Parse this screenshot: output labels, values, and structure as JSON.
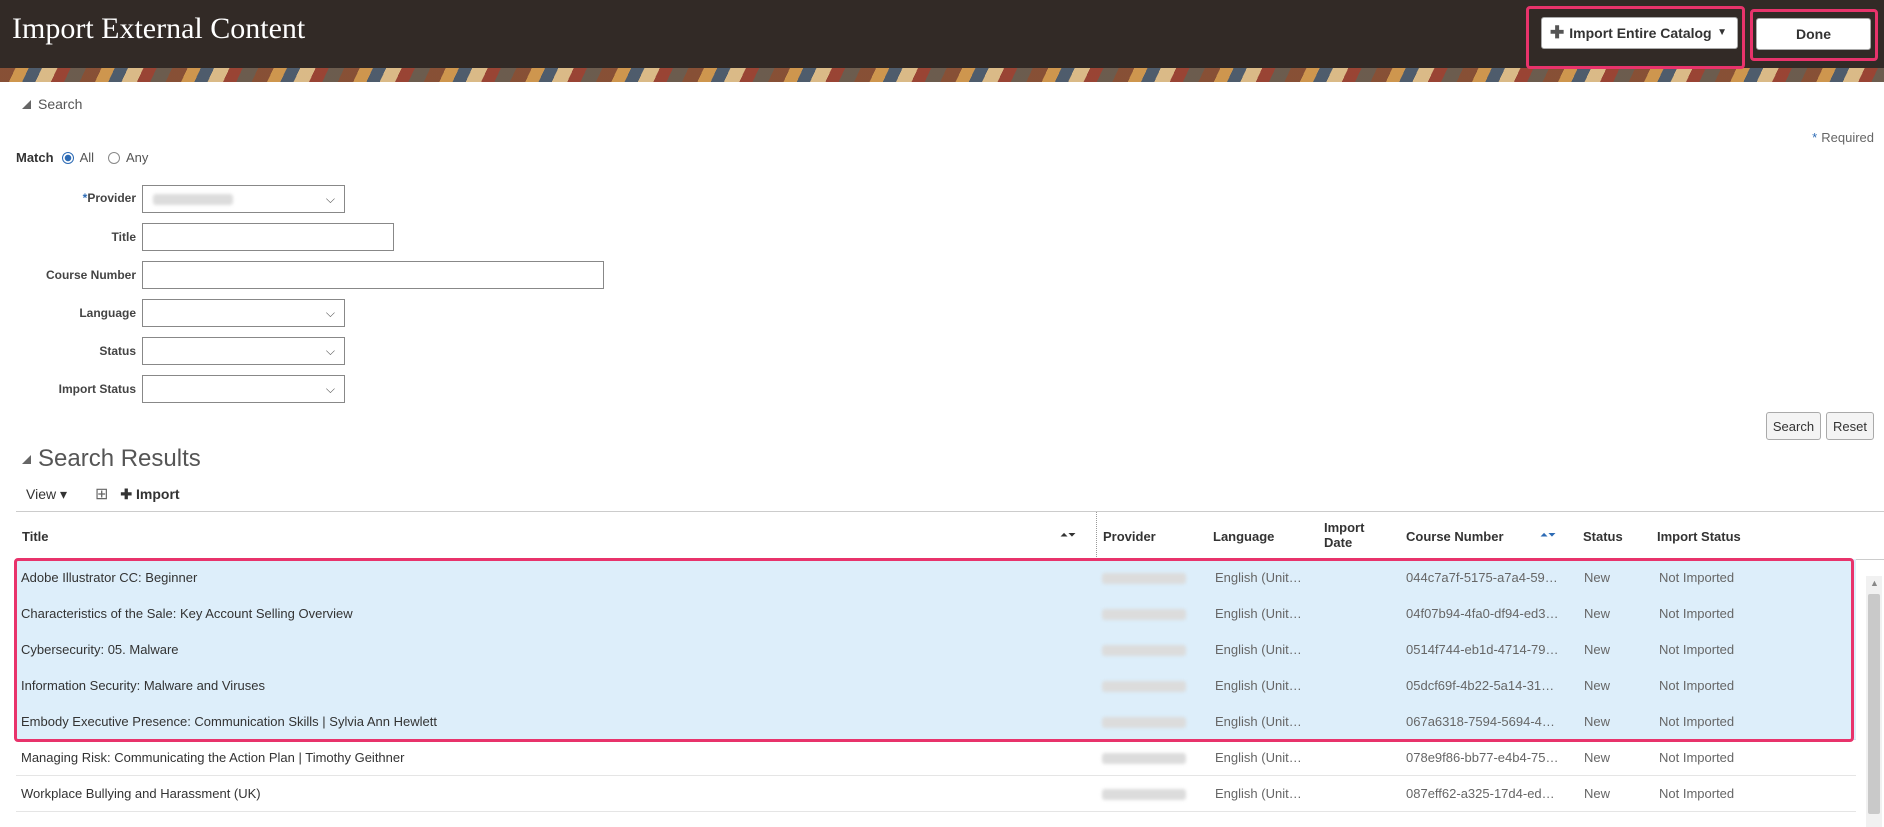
{
  "header": {
    "title": "Import External Content",
    "import_catalog_label": "Import Entire Catalog",
    "done_label": "Done"
  },
  "search": {
    "section_label": "Search",
    "required_label": "Required",
    "match_label": "Match",
    "match_options": [
      "All",
      "Any"
    ],
    "match_selected": "All",
    "fields": {
      "provider_label": "Provider",
      "title_label": "Title",
      "course_number_label": "Course Number",
      "language_label": "Language",
      "status_label": "Status",
      "import_status_label": "Import Status"
    },
    "search_button": "Search",
    "reset_button": "Reset"
  },
  "results": {
    "section_label": "Search Results",
    "view_label": "View",
    "import_label": "Import",
    "columns": {
      "title": "Title",
      "provider": "Provider",
      "language": "Language",
      "import_date": "Import Date",
      "course_number": "Course Number",
      "status": "Status",
      "import_status": "Import Status"
    },
    "rows": [
      {
        "title": "Adobe Illustrator CC: Beginner",
        "language": "English (Unit…",
        "course_number": "044c7a7f-5175-a7a4-59…",
        "status": "New",
        "import_status": "Not Imported",
        "selected": true
      },
      {
        "title": "Characteristics of the Sale: Key Account Selling Overview",
        "language": "English (Unit…",
        "course_number": "04f07b94-4fa0-df94-ed3…",
        "status": "New",
        "import_status": "Not Imported",
        "selected": true
      },
      {
        "title": "Cybersecurity: 05. Malware",
        "language": "English (Unit…",
        "course_number": "0514f744-eb1d-4714-79…",
        "status": "New",
        "import_status": "Not Imported",
        "selected": true
      },
      {
        "title": "Information Security: Malware and Viruses",
        "language": "English (Unit…",
        "course_number": "05dcf69f-4b22-5a14-31…",
        "status": "New",
        "import_status": "Not Imported",
        "selected": true
      },
      {
        "title": "Embody Executive Presence: Communication Skills | Sylvia Ann Hewlett",
        "language": "English (Unit…",
        "course_number": "067a6318-7594-5694-4…",
        "status": "New",
        "import_status": "Not Imported",
        "selected": true
      },
      {
        "title": "Managing Risk: Communicating the Action Plan | Timothy Geithner",
        "language": "English (Unit…",
        "course_number": "078e9f86-bb77-e4b4-75…",
        "status": "New",
        "import_status": "Not Imported",
        "selected": false
      },
      {
        "title": "Workplace Bullying and Harassment (UK)",
        "language": "English (Unit…",
        "course_number": "087eff62-a325-17d4-ed…",
        "status": "New",
        "import_status": "Not Imported",
        "selected": false
      }
    ]
  },
  "colors": {
    "header_bg": "#322a26",
    "highlight": "#e8336b",
    "selected_row": "#ddeefa",
    "accent": "#2d6bb5"
  }
}
